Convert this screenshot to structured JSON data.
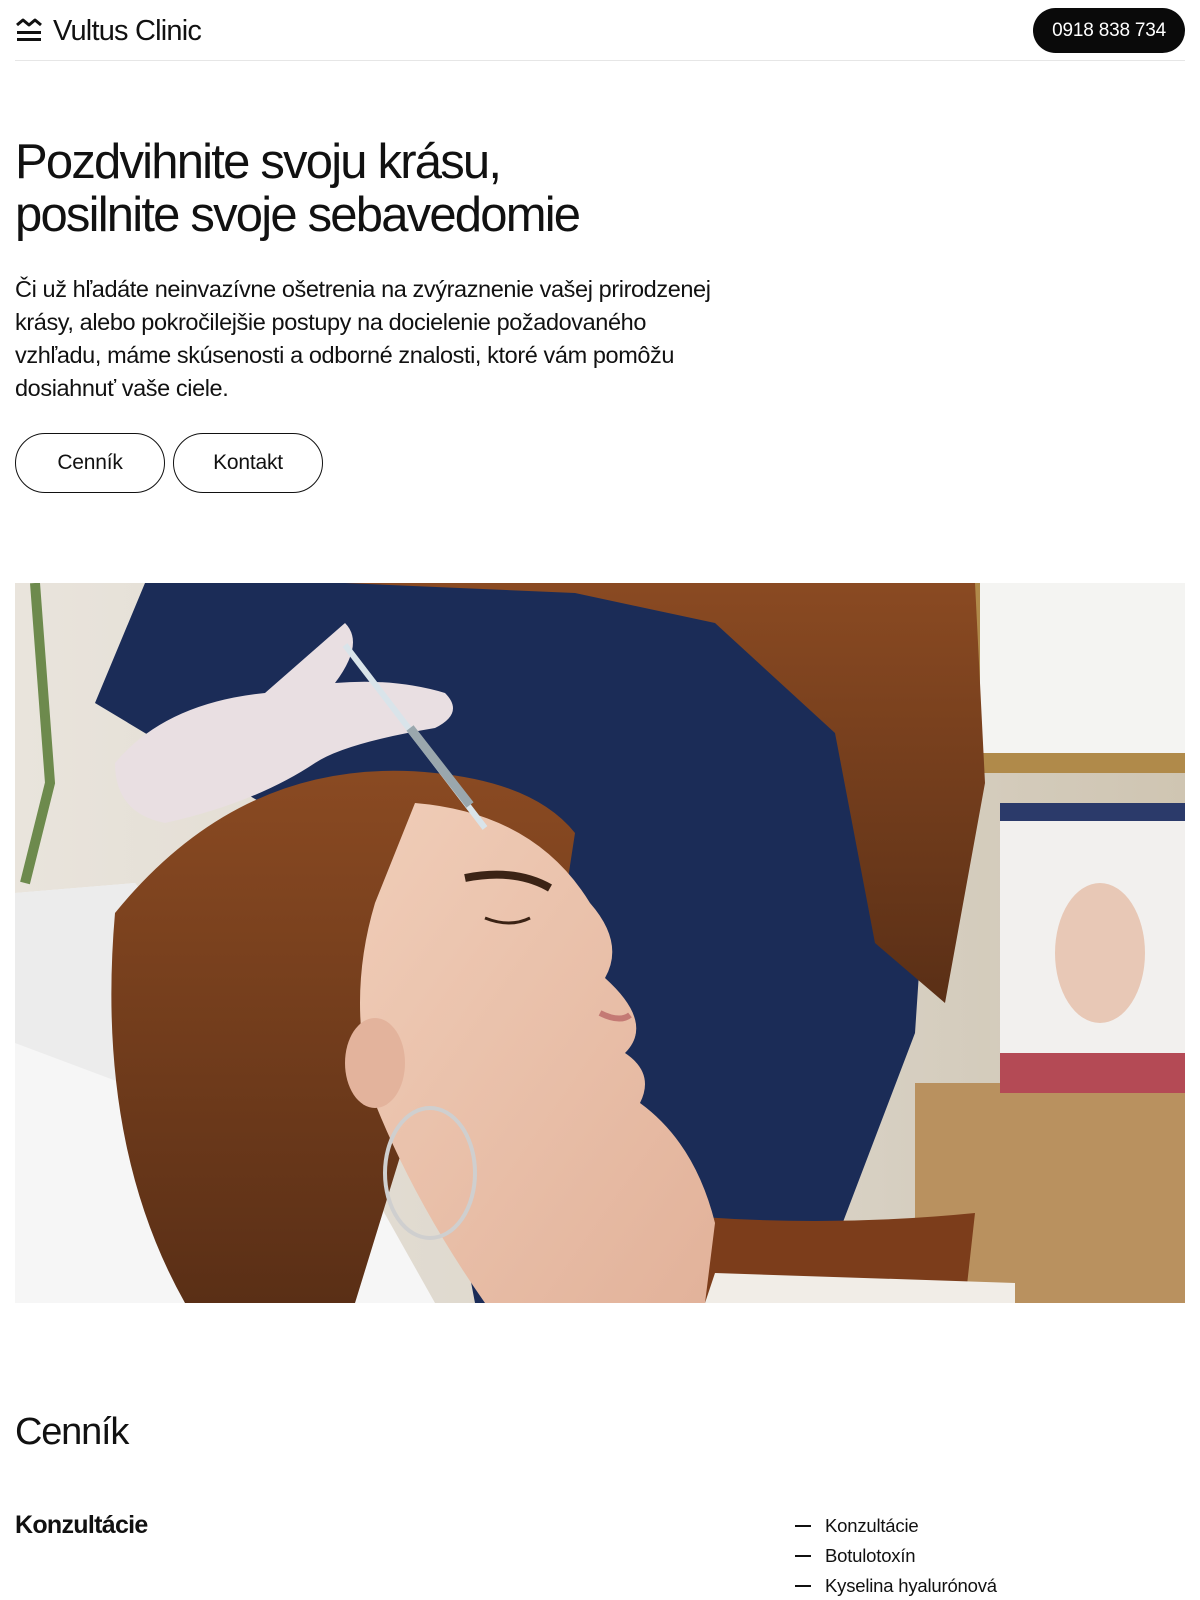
{
  "header": {
    "brand": "Vultus Clinic",
    "logo_icon": "wave-lines-logo-icon",
    "phone": "0918 838 734"
  },
  "hero": {
    "title_line1": "Pozdvihnite svoju krásu,",
    "title_line2": "posilnite svoje sebavedomie",
    "text": "Či už hľadáte neinvazívne ošetrenia na zvýraznenie vašej prirodzenej krásy, alebo pokročilejšie postupy na docielenie požadovaného vzhľadu, máme skúsenosti a odborné znalosti, ktoré vám pomôžu dosiahnuť vaše ciele.",
    "buttons": [
      {
        "label": "Cenník"
      },
      {
        "label": "Kontakt"
      }
    ]
  },
  "pricing": {
    "title": "Cenník",
    "category": "Konzultácie",
    "nav": [
      {
        "label": "Konzultácie"
      },
      {
        "label": "Botulotoxín"
      },
      {
        "label": "Kyselina hyalurónová"
      }
    ]
  },
  "colors": {
    "text": "#111111",
    "background": "#ffffff",
    "phone_button": "#0a0a0a",
    "scrubs": "#1b2c57"
  }
}
